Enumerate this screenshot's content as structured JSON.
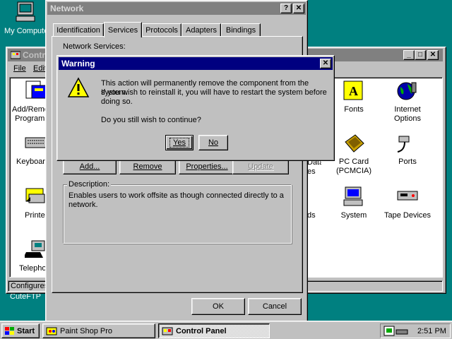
{
  "desktop": {
    "my_computer": "My Computer",
    "cuteftp": "CuteFTP"
  },
  "control_panel": {
    "title": "Control Panel",
    "menu": [
      "File",
      "Edit"
    ],
    "status": "Configures",
    "left_icons": [
      "Add/Remove Programs",
      "Keyboard",
      "Printers",
      "Telephony"
    ],
    "right_icons": [
      {
        "label": "Fonts",
        "icon": "fonts-icon"
      },
      {
        "label": "Internet Options",
        "icon": "internet-options-icon"
      },
      {
        "label": "PC Card (PCMCIA)",
        "icon": "pc-card-icon"
      },
      {
        "label": "Ports",
        "icon": "ports-icon"
      },
      {
        "label": "System",
        "icon": "system-icon"
      },
      {
        "label": "Tape Devices",
        "icon": "tape-devices-icon"
      }
    ],
    "partial_labels": [
      "Data",
      "es",
      "ds"
    ]
  },
  "network": {
    "title": "Network",
    "tabs": [
      "Identification",
      "Services",
      "Protocols",
      "Adapters",
      "Bindings"
    ],
    "active_tab": "Services",
    "services_label": "Network Services:",
    "add": "Add...",
    "remove": "Remove",
    "properties": "Properties...",
    "update": "Update",
    "description_label": "Description:",
    "description": "Enables users to work offsite as though connected directly to a network.",
    "ok": "OK",
    "cancel": "Cancel"
  },
  "warning": {
    "title": "Warning",
    "line1": "This action will permanently remove the component from the system.",
    "line2": "If you wish to reinstall it, you will have to restart the system before doing so.",
    "question": "Do you still wish to continue?",
    "yes": "Yes",
    "no": "No"
  },
  "taskbar": {
    "start": "Start",
    "tasks": [
      "Paint Shop Pro",
      "Control Panel"
    ],
    "clock": "2:51 PM"
  }
}
